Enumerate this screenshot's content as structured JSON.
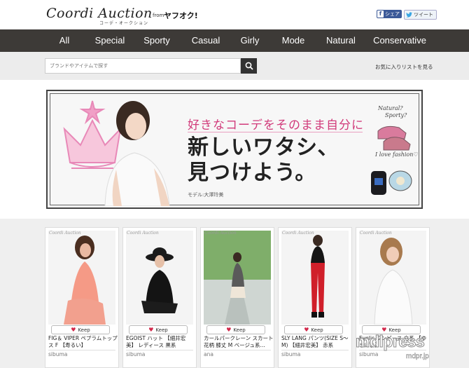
{
  "header": {
    "logo": "Coordi Auction",
    "logo_sub": "コーデ・オークション",
    "from": "from",
    "partner": "ヤフオク!",
    "share_facebook": "シェア",
    "share_twitter": "ツイート"
  },
  "nav": {
    "items": [
      "All",
      "Special",
      "Sporty",
      "Casual",
      "Girly",
      "Mode",
      "Natural",
      "Conservative"
    ]
  },
  "search": {
    "placeholder": "ブランドやアイテムで探す",
    "favorites_link": "お気に入りリストを見る"
  },
  "banner": {
    "tagline": "好きなコーデをそのまま自分に",
    "headline_line1": "新しいワタシ、",
    "headline_line2": "見つけよう。",
    "model_credit": "モデル:大澤玲美",
    "side_text_1": "Natural?",
    "side_text_2": "Sporty?",
    "side_text_3": "I love fashion♡"
  },
  "cards": [
    {
      "brand": "Coordi Auction",
      "keep": "Keep",
      "title": "FIG＆ VIPER ペプラムトップス F 【寿るい】",
      "user": "sibuma"
    },
    {
      "brand": "Coordi Auction",
      "keep": "Keep",
      "title": "EGOIST ハット 【細井宏美】 レディース 黒系",
      "user": "sibuma"
    },
    {
      "brand": "Coordi Auction",
      "keep": "Keep",
      "title": "カールパークレーン スカート 花柄 膝丈 M ベージュ系...",
      "user": "ana"
    },
    {
      "brand": "Coordi Auction",
      "keep": "Keep",
      "title": "SLY LANG パンツ(SIZE S〜M) 【細井宏美】 赤系",
      "user": "sibuma"
    },
    {
      "brand": "Coordi Auction",
      "keep": "Keep",
      "title": "Eyelis ワンピース 白系 【ゆきぽよ】",
      "user": "sibuma"
    }
  ],
  "watermark": {
    "main": "mdlpress",
    "sub": "mdpr.jp"
  },
  "colors": {
    "nav_bg": "#3d3a37",
    "accent_pink": "#d13a7a",
    "keep_heart": "#d2274a"
  }
}
